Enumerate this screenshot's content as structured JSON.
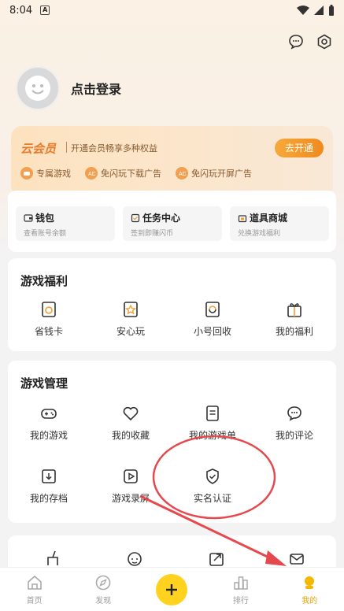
{
  "status": {
    "time": "8:04",
    "notif": "A"
  },
  "profile": {
    "login": "点击登录"
  },
  "vip": {
    "title": "云会员",
    "desc": "开通会员畅享多种权益",
    "button": "去开通",
    "perks": [
      "专属游戏",
      "免闪玩下载广告",
      "免闪玩开屏广告"
    ]
  },
  "quick": [
    {
      "title": "钱包",
      "sub": "查看账号余额"
    },
    {
      "title": "任务中心",
      "sub": "签到即赚闪币"
    },
    {
      "title": "道具商城",
      "sub": "兑换游戏福利"
    }
  ],
  "welfare": {
    "title": "游戏福利",
    "items": [
      "省钱卡",
      "安心玩",
      "小号回收",
      "我的福利"
    ]
  },
  "manage": {
    "title": "游戏管理",
    "items": [
      "我的游戏",
      "我的收藏",
      "我的游戏单",
      "我的评论",
      "我的存档",
      "游戏录屏",
      "实名认证"
    ]
  },
  "tabs": [
    "首页",
    "发现",
    "",
    "排行",
    "我的"
  ],
  "colors": {
    "accent": "#ffd21f",
    "vip_orange": "#f08a1e",
    "annotation_red": "#e5484d"
  }
}
